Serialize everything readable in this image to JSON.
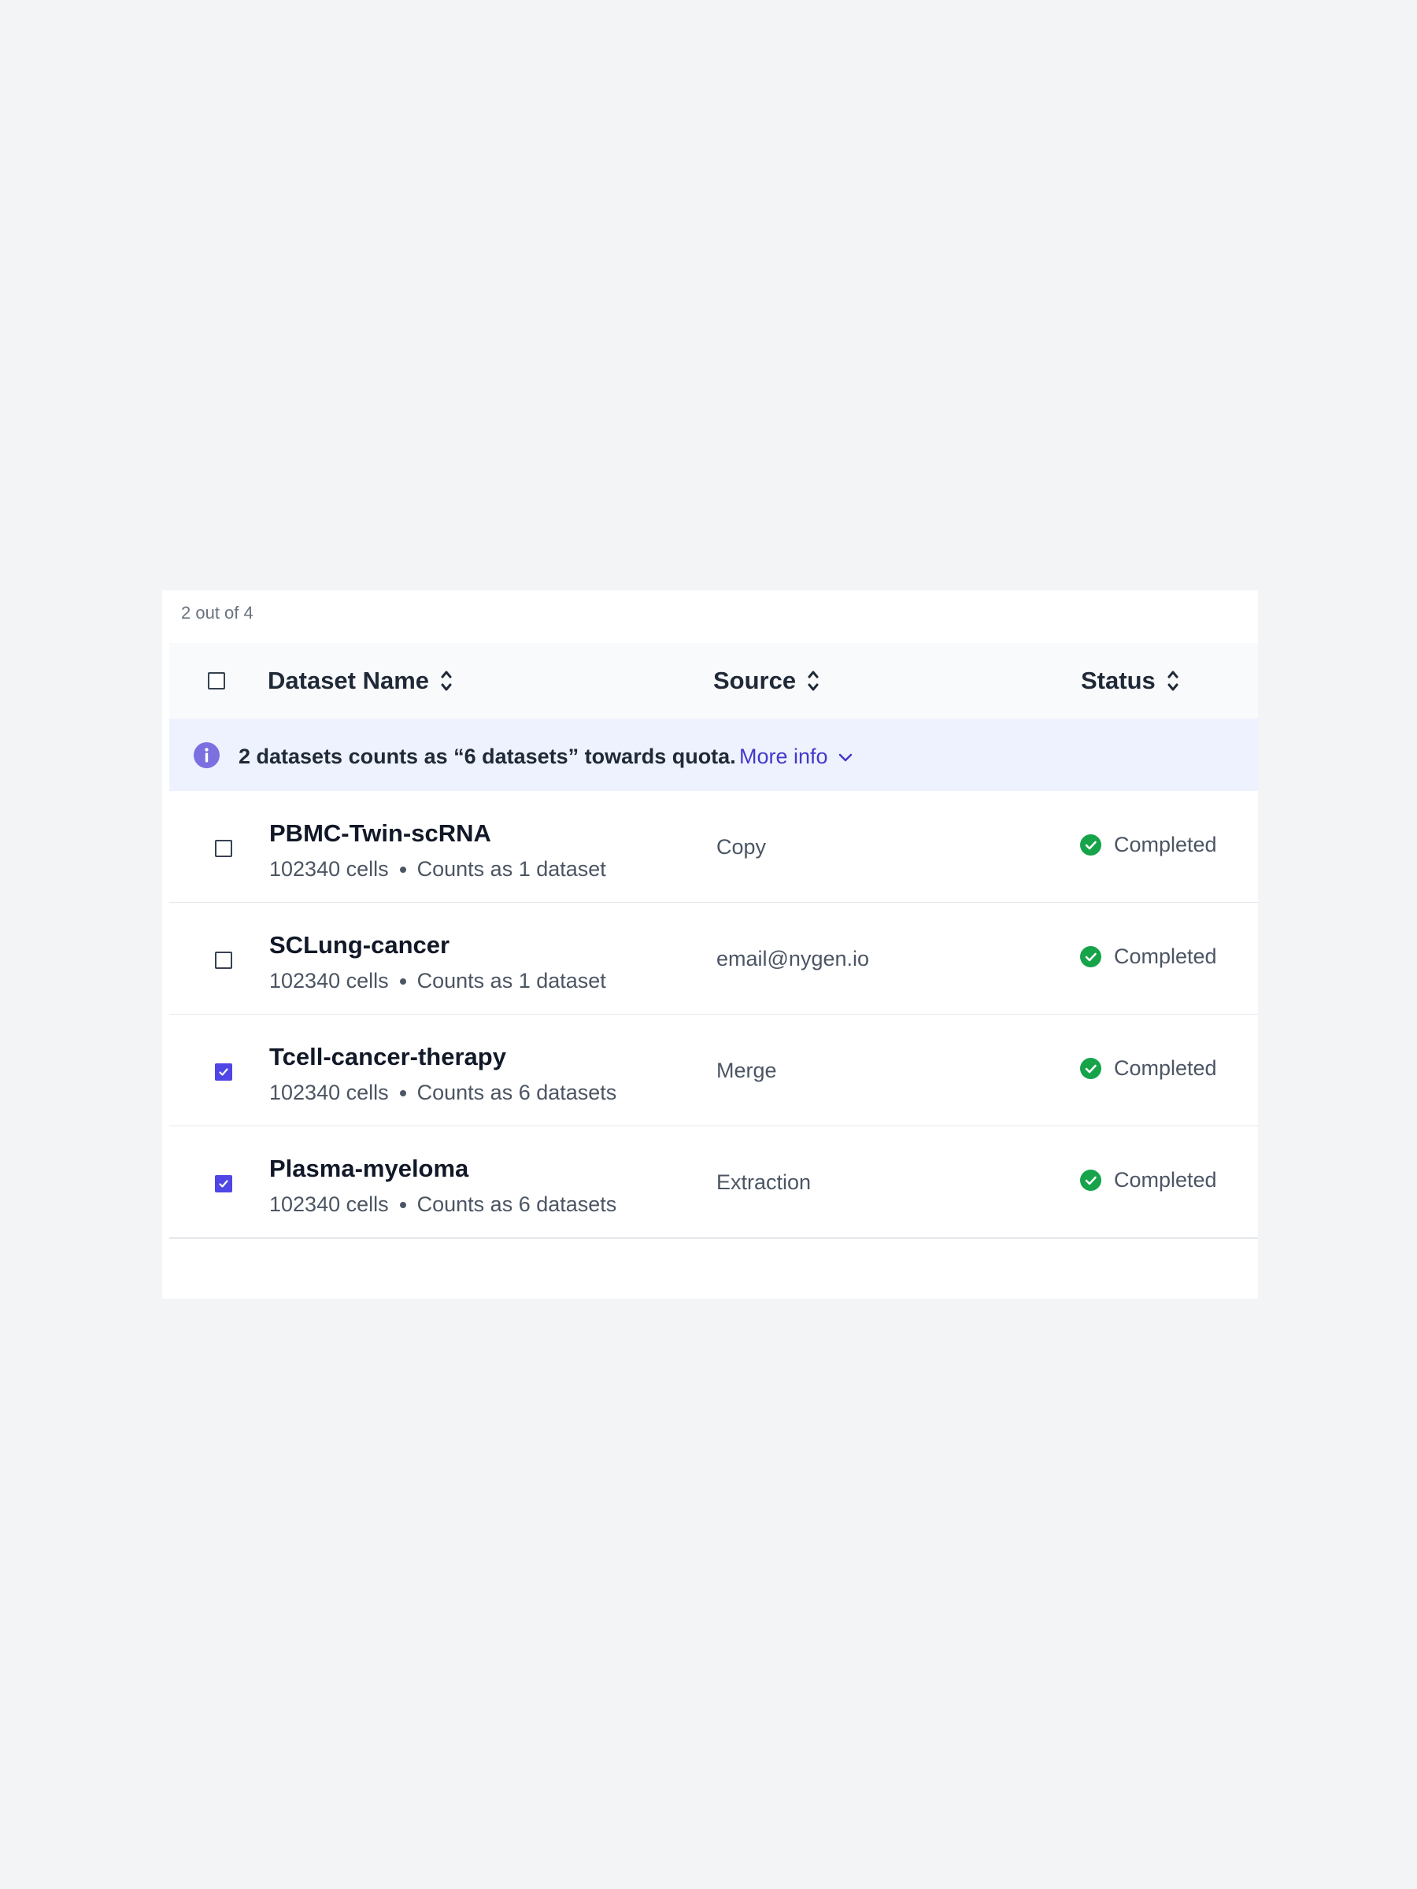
{
  "selection": {
    "count_text": "2 out of 4"
  },
  "table": {
    "columns": [
      {
        "label": "Dataset Name"
      },
      {
        "label": "Source"
      },
      {
        "label": "Status"
      }
    ]
  },
  "banner": {
    "text": "2 datasets counts as “6 datasets” towards quota.",
    "link_label": "More info"
  },
  "rows": [
    {
      "name": "PBMC-Twin-scRNA",
      "cells": "102340 cells",
      "counts": "Counts as 1 dataset",
      "source": "Copy",
      "status": "Completed",
      "checked": false
    },
    {
      "name": "SCLung-cancer",
      "cells": "102340 cells",
      "counts": "Counts as 1 dataset",
      "source": "email@nygen.io",
      "status": "Completed",
      "checked": false
    },
    {
      "name": "Tcell-cancer-therapy",
      "cells": "102340 cells",
      "counts": "Counts as 6 datasets",
      "source": "Merge",
      "status": "Completed",
      "checked": true
    },
    {
      "name": "Plasma-myeloma",
      "cells": "102340 cells",
      "counts": "Counts as 6 datasets",
      "source": "Extraction",
      "status": "Completed",
      "checked": true
    }
  ],
  "colors": {
    "accent": "#4f46e5",
    "link": "#4338ca",
    "success": "#16a34a",
    "banner_bg": "#eef2ff",
    "info_icon": "#7c6fe0"
  },
  "icons": {
    "sort": "sort-icon",
    "info": "info-icon",
    "status": "check-circle-icon",
    "link_chevron": "chevron-down-icon",
    "checkmark": "checkmark-icon"
  }
}
